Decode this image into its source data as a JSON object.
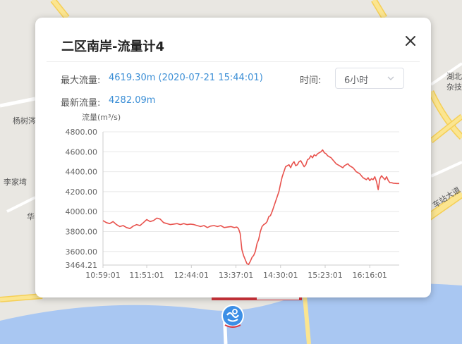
{
  "map": {
    "labels": {
      "yangshu": "杨树涔",
      "lijia": "李家塆",
      "hua": "华",
      "hubei": "湖北",
      "zaji": "杂技",
      "chezhan": "车站大道"
    },
    "colors": {
      "land": "#e9e7e2",
      "road_major": "#f7d96b",
      "road_minor": "#ffffff",
      "water": "#a9c7f2"
    }
  },
  "popup": {
    "title": "二区南岸-流量计4",
    "close_icon": "close-icon",
    "max_flow_label": "最大流量:",
    "max_flow_value": "4619.30m (2020-07-21 15:44:01)",
    "latest_flow_label": "最新流量:",
    "latest_flow_value": "4282.09m",
    "time_label": "时间:",
    "time_select": {
      "value": "6小时",
      "arrow_icon": "chevron-down-icon"
    }
  },
  "chart_data": {
    "type": "line",
    "ylabel": "流量(m³/s)",
    "ylim": [
      3464.21,
      4800
    ],
    "y_ticks": [
      "4800.00",
      "4600.00",
      "4400.00",
      "4200.00",
      "4000.00",
      "3800.00",
      "3600.00",
      "3464.21"
    ],
    "y_tick_values": [
      4800,
      4600,
      4400,
      4200,
      4000,
      3800,
      3600,
      3464.21
    ],
    "x_ticks": [
      "10:59:01",
      "11:51:01",
      "12:44:01",
      "13:37:01",
      "14:30:01",
      "15:23:01",
      "16:16:01"
    ],
    "x_tick_minutes": [
      659,
      711,
      764,
      817,
      870,
      923,
      976
    ],
    "xlim_minutes": [
      659,
      1011
    ],
    "grid": true,
    "line_color": "#e8524d",
    "series": [
      {
        "x": [
          659,
          663,
          667,
          671,
          675,
          679,
          683,
          687,
          691,
          695,
          699,
          703,
          707,
          711,
          715,
          719,
          723,
          727,
          731,
          735,
          739,
          743,
          747,
          751,
          755,
          759,
          763,
          767,
          771,
          775,
          779,
          783,
          787,
          791,
          795,
          799,
          803,
          807,
          811,
          815,
          818,
          820,
          822,
          824,
          826,
          828,
          830,
          832,
          834,
          836,
          838,
          840,
          842,
          844,
          846,
          848,
          850,
          852,
          854,
          856,
          858,
          860,
          862,
          864,
          866,
          868,
          870,
          872,
          874,
          876,
          878,
          880,
          882,
          884,
          886,
          888,
          890,
          892,
          894,
          896,
          898,
          900,
          902,
          904,
          906,
          908,
          910,
          912,
          914,
          916,
          918,
          920,
          922,
          924,
          926,
          928,
          930,
          932,
          934,
          936,
          938,
          940,
          942,
          944,
          946,
          948,
          950,
          952,
          954,
          956,
          958,
          960,
          962,
          964,
          966,
          968,
          970,
          972,
          974,
          976,
          978,
          980,
          982,
          984,
          986,
          988,
          990,
          992,
          994,
          996,
          998,
          1000,
          1002,
          1004,
          1006,
          1008,
          1011
        ],
        "values": [
          3910,
          3890,
          3880,
          3900,
          3870,
          3850,
          3860,
          3840,
          3830,
          3855,
          3870,
          3860,
          3890,
          3920,
          3900,
          3910,
          3935,
          3925,
          3890,
          3880,
          3870,
          3875,
          3880,
          3870,
          3880,
          3870,
          3875,
          3870,
          3860,
          3850,
          3860,
          3840,
          3855,
          3860,
          3850,
          3860,
          3840,
          3845,
          3850,
          3840,
          3845,
          3830,
          3780,
          3620,
          3560,
          3520,
          3480,
          3470,
          3500,
          3540,
          3560,
          3600,
          3680,
          3720,
          3800,
          3850,
          3870,
          3880,
          3900,
          3950,
          3960,
          4000,
          4050,
          4100,
          4150,
          4200,
          4280,
          4350,
          4400,
          4450,
          4460,
          4470,
          4440,
          4480,
          4500,
          4460,
          4470,
          4500,
          4510,
          4480,
          4450,
          4470,
          4520,
          4530,
          4560,
          4540,
          4570,
          4560,
          4580,
          4590,
          4600,
          4619.3,
          4590,
          4580,
          4560,
          4550,
          4540,
          4520,
          4500,
          4480,
          4470,
          4460,
          4450,
          4440,
          4460,
          4470,
          4480,
          4460,
          4450,
          4440,
          4420,
          4400,
          4390,
          4380,
          4360,
          4340,
          4330,
          4320,
          4340,
          4310,
          4330,
          4320,
          4350,
          4300,
          4220,
          4330,
          4360,
          4340,
          4320,
          4350,
          4310,
          4290,
          4290,
          4285,
          4283,
          4282.09,
          4282.09
        ]
      }
    ]
  }
}
